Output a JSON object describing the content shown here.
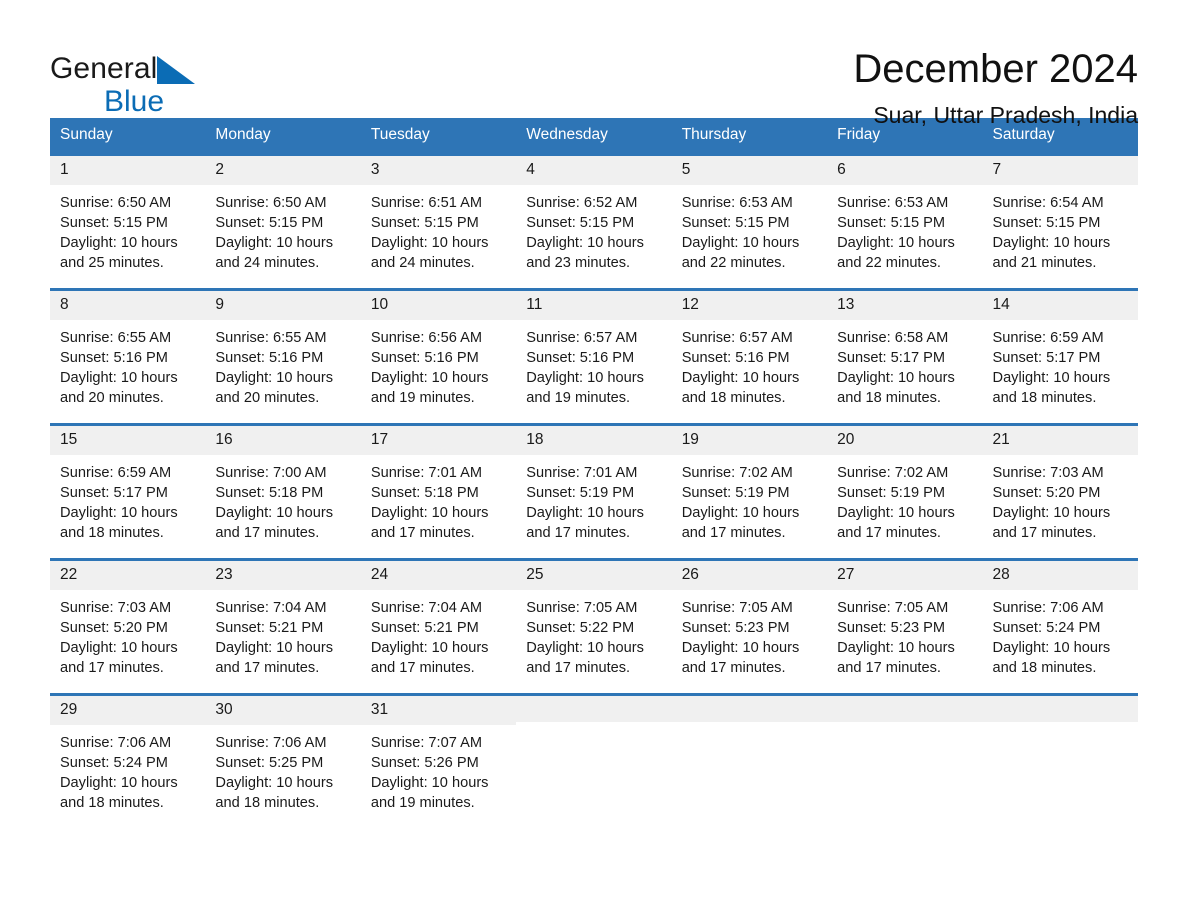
{
  "brand": {
    "name_part1": "General",
    "name_part2": "Blue",
    "logo_icon": "triangle-logo-icon",
    "accent_color": "#0b6cb5"
  },
  "header": {
    "title": "December 2024",
    "location": "Suar, Uttar Pradesh, India"
  },
  "theme": {
    "header_blue": "#2e75b6",
    "daynum_band": "#f0f0f0",
    "text": "#1a1a1a"
  },
  "calendar": {
    "weekday_headers": [
      "Sunday",
      "Monday",
      "Tuesday",
      "Wednesday",
      "Thursday",
      "Friday",
      "Saturday"
    ],
    "weeks": [
      [
        {
          "day": "1",
          "sunrise": "Sunrise: 6:50 AM",
          "sunset": "Sunset: 5:15 PM",
          "daylight_line1": "Daylight: 10 hours",
          "daylight_line2": "and 25 minutes."
        },
        {
          "day": "2",
          "sunrise": "Sunrise: 6:50 AM",
          "sunset": "Sunset: 5:15 PM",
          "daylight_line1": "Daylight: 10 hours",
          "daylight_line2": "and 24 minutes."
        },
        {
          "day": "3",
          "sunrise": "Sunrise: 6:51 AM",
          "sunset": "Sunset: 5:15 PM",
          "daylight_line1": "Daylight: 10 hours",
          "daylight_line2": "and 24 minutes."
        },
        {
          "day": "4",
          "sunrise": "Sunrise: 6:52 AM",
          "sunset": "Sunset: 5:15 PM",
          "daylight_line1": "Daylight: 10 hours",
          "daylight_line2": "and 23 minutes."
        },
        {
          "day": "5",
          "sunrise": "Sunrise: 6:53 AM",
          "sunset": "Sunset: 5:15 PM",
          "daylight_line1": "Daylight: 10 hours",
          "daylight_line2": "and 22 minutes."
        },
        {
          "day": "6",
          "sunrise": "Sunrise: 6:53 AM",
          "sunset": "Sunset: 5:15 PM",
          "daylight_line1": "Daylight: 10 hours",
          "daylight_line2": "and 22 minutes."
        },
        {
          "day": "7",
          "sunrise": "Sunrise: 6:54 AM",
          "sunset": "Sunset: 5:15 PM",
          "daylight_line1": "Daylight: 10 hours",
          "daylight_line2": "and 21 minutes."
        }
      ],
      [
        {
          "day": "8",
          "sunrise": "Sunrise: 6:55 AM",
          "sunset": "Sunset: 5:16 PM",
          "daylight_line1": "Daylight: 10 hours",
          "daylight_line2": "and 20 minutes."
        },
        {
          "day": "9",
          "sunrise": "Sunrise: 6:55 AM",
          "sunset": "Sunset: 5:16 PM",
          "daylight_line1": "Daylight: 10 hours",
          "daylight_line2": "and 20 minutes."
        },
        {
          "day": "10",
          "sunrise": "Sunrise: 6:56 AM",
          "sunset": "Sunset: 5:16 PM",
          "daylight_line1": "Daylight: 10 hours",
          "daylight_line2": "and 19 minutes."
        },
        {
          "day": "11",
          "sunrise": "Sunrise: 6:57 AM",
          "sunset": "Sunset: 5:16 PM",
          "daylight_line1": "Daylight: 10 hours",
          "daylight_line2": "and 19 minutes."
        },
        {
          "day": "12",
          "sunrise": "Sunrise: 6:57 AM",
          "sunset": "Sunset: 5:16 PM",
          "daylight_line1": "Daylight: 10 hours",
          "daylight_line2": "and 18 minutes."
        },
        {
          "day": "13",
          "sunrise": "Sunrise: 6:58 AM",
          "sunset": "Sunset: 5:17 PM",
          "daylight_line1": "Daylight: 10 hours",
          "daylight_line2": "and 18 minutes."
        },
        {
          "day": "14",
          "sunrise": "Sunrise: 6:59 AM",
          "sunset": "Sunset: 5:17 PM",
          "daylight_line1": "Daylight: 10 hours",
          "daylight_line2": "and 18 minutes."
        }
      ],
      [
        {
          "day": "15",
          "sunrise": "Sunrise: 6:59 AM",
          "sunset": "Sunset: 5:17 PM",
          "daylight_line1": "Daylight: 10 hours",
          "daylight_line2": "and 18 minutes."
        },
        {
          "day": "16",
          "sunrise": "Sunrise: 7:00 AM",
          "sunset": "Sunset: 5:18 PM",
          "daylight_line1": "Daylight: 10 hours",
          "daylight_line2": "and 17 minutes."
        },
        {
          "day": "17",
          "sunrise": "Sunrise: 7:01 AM",
          "sunset": "Sunset: 5:18 PM",
          "daylight_line1": "Daylight: 10 hours",
          "daylight_line2": "and 17 minutes."
        },
        {
          "day": "18",
          "sunrise": "Sunrise: 7:01 AM",
          "sunset": "Sunset: 5:19 PM",
          "daylight_line1": "Daylight: 10 hours",
          "daylight_line2": "and 17 minutes."
        },
        {
          "day": "19",
          "sunrise": "Sunrise: 7:02 AM",
          "sunset": "Sunset: 5:19 PM",
          "daylight_line1": "Daylight: 10 hours",
          "daylight_line2": "and 17 minutes."
        },
        {
          "day": "20",
          "sunrise": "Sunrise: 7:02 AM",
          "sunset": "Sunset: 5:19 PM",
          "daylight_line1": "Daylight: 10 hours",
          "daylight_line2": "and 17 minutes."
        },
        {
          "day": "21",
          "sunrise": "Sunrise: 7:03 AM",
          "sunset": "Sunset: 5:20 PM",
          "daylight_line1": "Daylight: 10 hours",
          "daylight_line2": "and 17 minutes."
        }
      ],
      [
        {
          "day": "22",
          "sunrise": "Sunrise: 7:03 AM",
          "sunset": "Sunset: 5:20 PM",
          "daylight_line1": "Daylight: 10 hours",
          "daylight_line2": "and 17 minutes."
        },
        {
          "day": "23",
          "sunrise": "Sunrise: 7:04 AM",
          "sunset": "Sunset: 5:21 PM",
          "daylight_line1": "Daylight: 10 hours",
          "daylight_line2": "and 17 minutes."
        },
        {
          "day": "24",
          "sunrise": "Sunrise: 7:04 AM",
          "sunset": "Sunset: 5:21 PM",
          "daylight_line1": "Daylight: 10 hours",
          "daylight_line2": "and 17 minutes."
        },
        {
          "day": "25",
          "sunrise": "Sunrise: 7:05 AM",
          "sunset": "Sunset: 5:22 PM",
          "daylight_line1": "Daylight: 10 hours",
          "daylight_line2": "and 17 minutes."
        },
        {
          "day": "26",
          "sunrise": "Sunrise: 7:05 AM",
          "sunset": "Sunset: 5:23 PM",
          "daylight_line1": "Daylight: 10 hours",
          "daylight_line2": "and 17 minutes."
        },
        {
          "day": "27",
          "sunrise": "Sunrise: 7:05 AM",
          "sunset": "Sunset: 5:23 PM",
          "daylight_line1": "Daylight: 10 hours",
          "daylight_line2": "and 17 minutes."
        },
        {
          "day": "28",
          "sunrise": "Sunrise: 7:06 AM",
          "sunset": "Sunset: 5:24 PM",
          "daylight_line1": "Daylight: 10 hours",
          "daylight_line2": "and 18 minutes."
        }
      ],
      [
        {
          "day": "29",
          "sunrise": "Sunrise: 7:06 AM",
          "sunset": "Sunset: 5:24 PM",
          "daylight_line1": "Daylight: 10 hours",
          "daylight_line2": "and 18 minutes."
        },
        {
          "day": "30",
          "sunrise": "Sunrise: 7:06 AM",
          "sunset": "Sunset: 5:25 PM",
          "daylight_line1": "Daylight: 10 hours",
          "daylight_line2": "and 18 minutes."
        },
        {
          "day": "31",
          "sunrise": "Sunrise: 7:07 AM",
          "sunset": "Sunset: 5:26 PM",
          "daylight_line1": "Daylight: 10 hours",
          "daylight_line2": "and 19 minutes."
        },
        {
          "day": "",
          "sunrise": "",
          "sunset": "",
          "daylight_line1": "",
          "daylight_line2": ""
        },
        {
          "day": "",
          "sunrise": "",
          "sunset": "",
          "daylight_line1": "",
          "daylight_line2": ""
        },
        {
          "day": "",
          "sunrise": "",
          "sunset": "",
          "daylight_line1": "",
          "daylight_line2": ""
        },
        {
          "day": "",
          "sunrise": "",
          "sunset": "",
          "daylight_line1": "",
          "daylight_line2": ""
        }
      ]
    ]
  }
}
